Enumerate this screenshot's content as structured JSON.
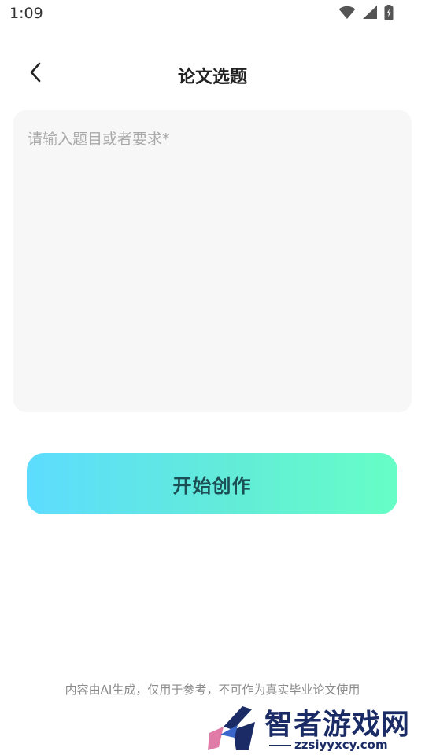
{
  "status_bar": {
    "time": "1:09",
    "icons": [
      "wifi-icon",
      "cell-signal-icon",
      "battery-charging-icon"
    ]
  },
  "header": {
    "back_icon": "chevron-left-icon",
    "title": "论文选题"
  },
  "topic_input": {
    "value": "",
    "placeholder": "请输入题目或者要求*"
  },
  "start_button": {
    "label": "开始创作",
    "gradient_start": "#5ddcfe",
    "gradient_end": "#66fec6",
    "text_color": "#1c4f55"
  },
  "disclaimer": "内容由AI生成，仅用于参考，不可作为真实毕业论文使用",
  "watermark": {
    "brand": "智者游戏网",
    "url": "zzsiyyxcy.com",
    "color": "#1a2b66"
  }
}
